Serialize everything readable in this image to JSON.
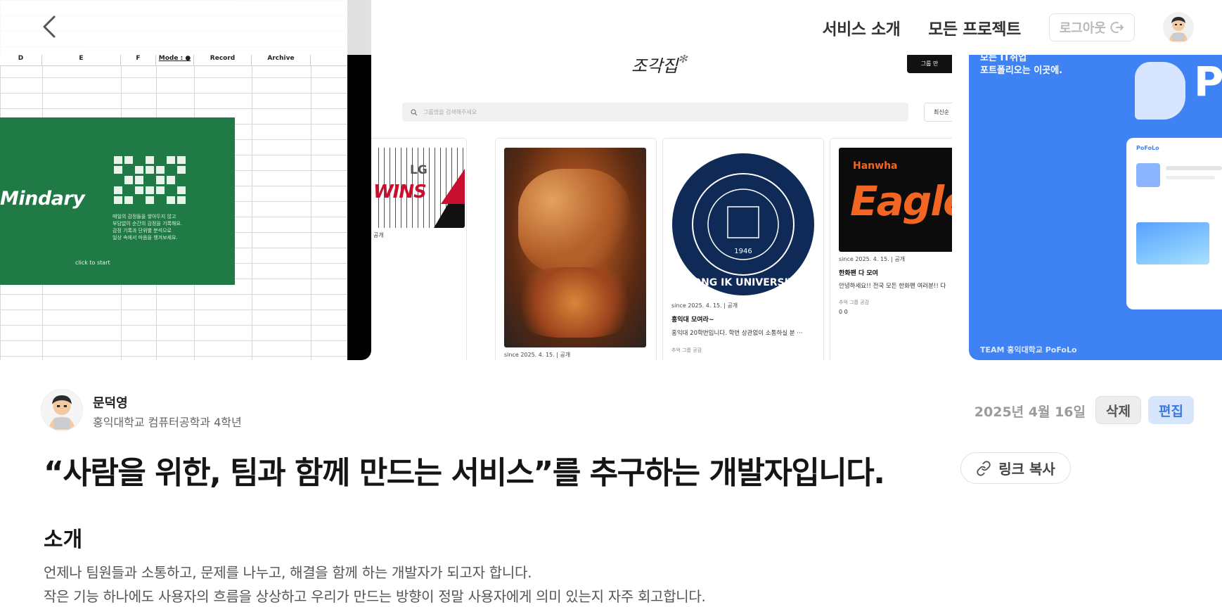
{
  "header": {
    "nav_service": "서비스 소개",
    "nav_projects": "모든 프로젝트",
    "logout_label": "로그아웃"
  },
  "gallery": {
    "shot1": {
      "columns": [
        "D",
        "E",
        "F",
        "Mode : ●",
        "Record",
        "Archive"
      ],
      "brand": "Mindary",
      "description": "매일의 감정들을 쌓아두지 않고\n부담없이 순간의 감정을 기록해요.\n감정 기록과 단위별 분석으로\n일상 속에서 마음을 챙겨보세요.",
      "cta": "click to start"
    },
    "shot2": {
      "logo": "조각집",
      "dark_tab": "그룹 만",
      "search_placeholder": "그룹명을 검색해주세요",
      "sort": "최신순",
      "card0_meta": "공개",
      "card1_meta": "since 2025. 4. 15.  |  공개",
      "card2": {
        "meta": "since 2025. 4. 15.  |  공개",
        "title": "홍익대 모여라~",
        "desc": "홍익대 20학번입니다. 학번 상관없이 소통하실 분 ···",
        "stats": "추억      그룹 공감"
      },
      "card3": {
        "brand": "Hanwha",
        "logo": "Eagle",
        "meta": "since 2025. 4. 15.  |  공개",
        "title": "한화팬 다 모여",
        "desc": "안녕하세요!! 전국 모든 한화팬 여러분!! 다",
        "stat_labels": "추억      그룹 공감",
        "stat_values": "0           0"
      },
      "card2_circle_text": "HONG IK UNIVERSITY",
      "card2_year": "1946"
    },
    "shot3": {
      "headline": "모든 IT취업\n포트폴리오는 이곳에.",
      "letter": "P",
      "card_brand": "PoFoLo",
      "team": "TEAM 홍익대학교 PoFoLo"
    }
  },
  "author": {
    "name": "문덕영",
    "school": "홍익대학교 컴퓨터공학과 4학년"
  },
  "post": {
    "date": "2025년 4월 16일",
    "delete_label": "삭제",
    "edit_label": "편집",
    "title": "“사람을 위한, 팀과 함께 만드는 서비스”를 추구하는 개발자입니다.",
    "copy_link_label": "링크 복사",
    "intro_heading": "소개",
    "intro_lines": [
      "언제나 팀원들과 소통하고, 문제를 나누고, 해결을 함께 하는 개발자가 되고자 합니다.",
      "작은 기능 하나에도 사용자의 흐름을 상상하고 우리가 만드는 방향이 정말 사용자에게 의미 있는지 자주 회고합니다."
    ]
  },
  "icons": {
    "back": "chevron-left-icon",
    "logout": "logout-icon",
    "avatar": "developer-avatar-icon",
    "link": "link-icon",
    "search": "search-icon"
  },
  "colors": {
    "accent_blue": "#3a7ae0",
    "edit_bg": "#d8e6fb",
    "mindary_green": "#1f7a45",
    "pofolo_blue": "#3e82f3",
    "hanwha_orange": "#f26522",
    "hongik_navy": "#0f2a57"
  }
}
